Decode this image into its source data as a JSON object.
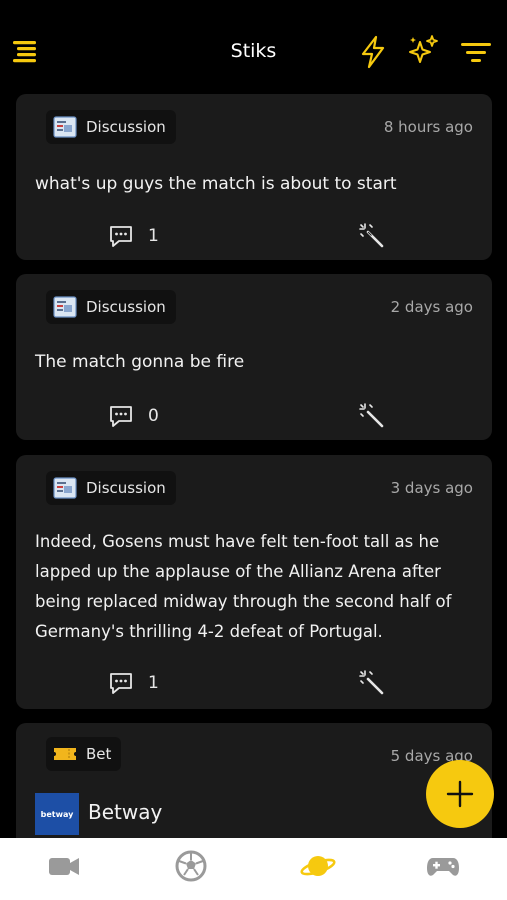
{
  "header": {
    "title": "Stiks",
    "icons": [
      "menu-icon",
      "lightning-icon",
      "sparkles-icon",
      "filter-icon"
    ],
    "accent_color": "#f6c90f"
  },
  "feed": {
    "posts": [
      {
        "tag": "Discussion",
        "time": "8 hours ago",
        "text": "what's up guys the match is about to start",
        "comment_count": "1"
      },
      {
        "tag": "Discussion",
        "time": "2 days ago",
        "text": "The match gonna be fire",
        "comment_count": "0"
      },
      {
        "tag": "Discussion",
        "time": "3 days ago",
        "text": "Indeed, Gosens must have felt ten-foot tall as he lapped up the applause of the Allianz Arena after being replaced midway through the second half of Germany's thrilling 4-2 defeat of Portugal.",
        "comment_count": "1"
      },
      {
        "tag": "Bet",
        "time": "5 days ago",
        "bet_logo_text": "betway",
        "bet_name": "Betway"
      }
    ]
  },
  "fab": {
    "icon": "plus-icon"
  },
  "tabbar": {
    "tabs": [
      "video-camera-icon",
      "soccer-ball-icon",
      "planet-icon",
      "gamepad-icon"
    ],
    "active_tab": "planet-icon"
  }
}
